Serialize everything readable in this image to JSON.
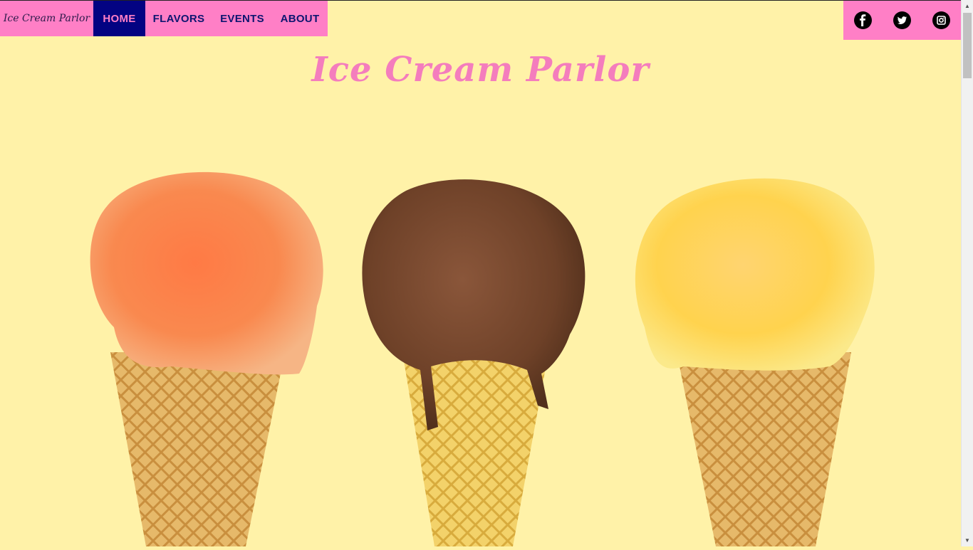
{
  "nav": {
    "brand": "Ice Cream Parlor",
    "items": [
      {
        "label": "HOME",
        "active": true
      },
      {
        "label": "FLAVORS",
        "active": false
      },
      {
        "label": "EVENTS",
        "active": false
      },
      {
        "label": "ABOUT",
        "active": false
      }
    ]
  },
  "social": {
    "icons": [
      "facebook-icon",
      "twitter-icon",
      "instagram-icon"
    ]
  },
  "hero": {
    "title": "Ice Cream Parlor",
    "image_subject": "three ice cream cones: orange, chocolate, mango"
  },
  "colors": {
    "background": "#fff2a8",
    "nav_pink": "#ff7fc6",
    "nav_active_bg": "#030382",
    "nav_text": "#0d1670",
    "title_pink": "#f47dbd"
  }
}
